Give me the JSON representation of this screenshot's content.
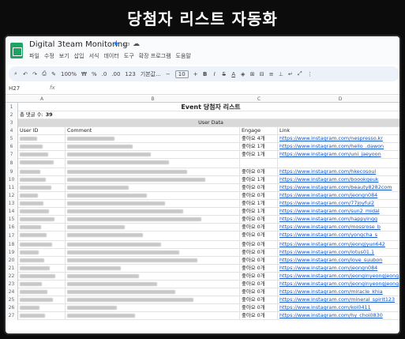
{
  "banner": {
    "title": "당첨자 리스트 자동화"
  },
  "app": {
    "doc_title": "Digital 3team Monitoring",
    "menu": [
      "파일",
      "수정",
      "보기",
      "삽입",
      "서식",
      "데이터",
      "도구",
      "확장 프로그램",
      "도움말"
    ],
    "zoom": "100%",
    "font": "기본값...",
    "font_size": "10",
    "cell_ref": "H27",
    "fx": "fx"
  },
  "columns": [
    "A",
    "B",
    "C",
    "D"
  ],
  "sheet": {
    "title": "Event 당첨자 리스트",
    "total_label": "총 댓글 수:",
    "total_value": "39",
    "section": "User Data",
    "headers": [
      "User ID",
      "Comment",
      "Engage",
      "Link"
    ],
    "rows": [
      {
        "n": "5",
        "engage": "좋아요 4개",
        "link": "https://www.instagram.com/nespresso.kr"
      },
      {
        "n": "6",
        "engage": "좋아요 1개",
        "link": "https://www.instagram.com/hello_.dawon"
      },
      {
        "n": "7",
        "engage": "좋아요 1개",
        "link": "https://www.instagram.com/uni_jaeyoon"
      },
      {
        "n": "8",
        "engage": "",
        "link": ""
      },
      {
        "n": "9",
        "engage": "좋아요 0개",
        "link": "https://www.instagram.com/hkecosoul"
      },
      {
        "n": "10",
        "engage": "좋아요 1개",
        "link": "https://www.instagram.com/boookgeuk"
      },
      {
        "n": "11",
        "engage": "좋아요 0개",
        "link": "https://www.instagram.com/beauty8282com"
      },
      {
        "n": "12",
        "engage": "좋아요 0개",
        "link": "https://www.instagram.com/jeongn084"
      },
      {
        "n": "13",
        "engage": "좋아요 1개",
        "link": "https://www.instagram.com/77joyful2"
      },
      {
        "n": "14",
        "engage": "좋아요 1개",
        "link": "https://www.instagram.com/sun2_midal"
      },
      {
        "n": "15",
        "engage": "좋아요 0개",
        "link": "https://www.instagram.com/happyingg"
      },
      {
        "n": "16",
        "engage": "좋아요 0개",
        "link": "https://www.instagram.com/mossrose_b"
      },
      {
        "n": "17",
        "engage": "좋아요 0개",
        "link": "https://www.instagram.com/yongcha_s"
      },
      {
        "n": "18",
        "engage": "좋아요 0개",
        "link": "https://www.instagram.com/jeongjyun642"
      },
      {
        "n": "19",
        "engage": "좋아요 0개",
        "link": "https://www.instagram.com/lotus01.1"
      },
      {
        "n": "20",
        "engage": "좋아요 0개",
        "link": "https://www.instagram.com/love_suubon"
      },
      {
        "n": "21",
        "engage": "좋아요 0개",
        "link": "https://www.instagram.com/jeongn084"
      },
      {
        "n": "22",
        "engage": "좋아요 0개",
        "link": "https://www.instagram.com/jeonginyeongjeong"
      },
      {
        "n": "23",
        "engage": "좋아요 0개",
        "link": "https://www.instagram.com/jeonginyeongjeong"
      },
      {
        "n": "24",
        "engage": "좋아요 0개",
        "link": "https://www.instagram.com/miracle_khia"
      },
      {
        "n": "25",
        "engage": "좋아요 0개",
        "link": "https://www.instagram.com/mineral_spirit123"
      },
      {
        "n": "26",
        "engage": "좋아요 0개",
        "link": "https://www.instagram.com/koi0411"
      },
      {
        "n": "27",
        "engage": "좋아요 0개",
        "link": "https://www.instagram.com/hy_choi0830"
      }
    ]
  }
}
